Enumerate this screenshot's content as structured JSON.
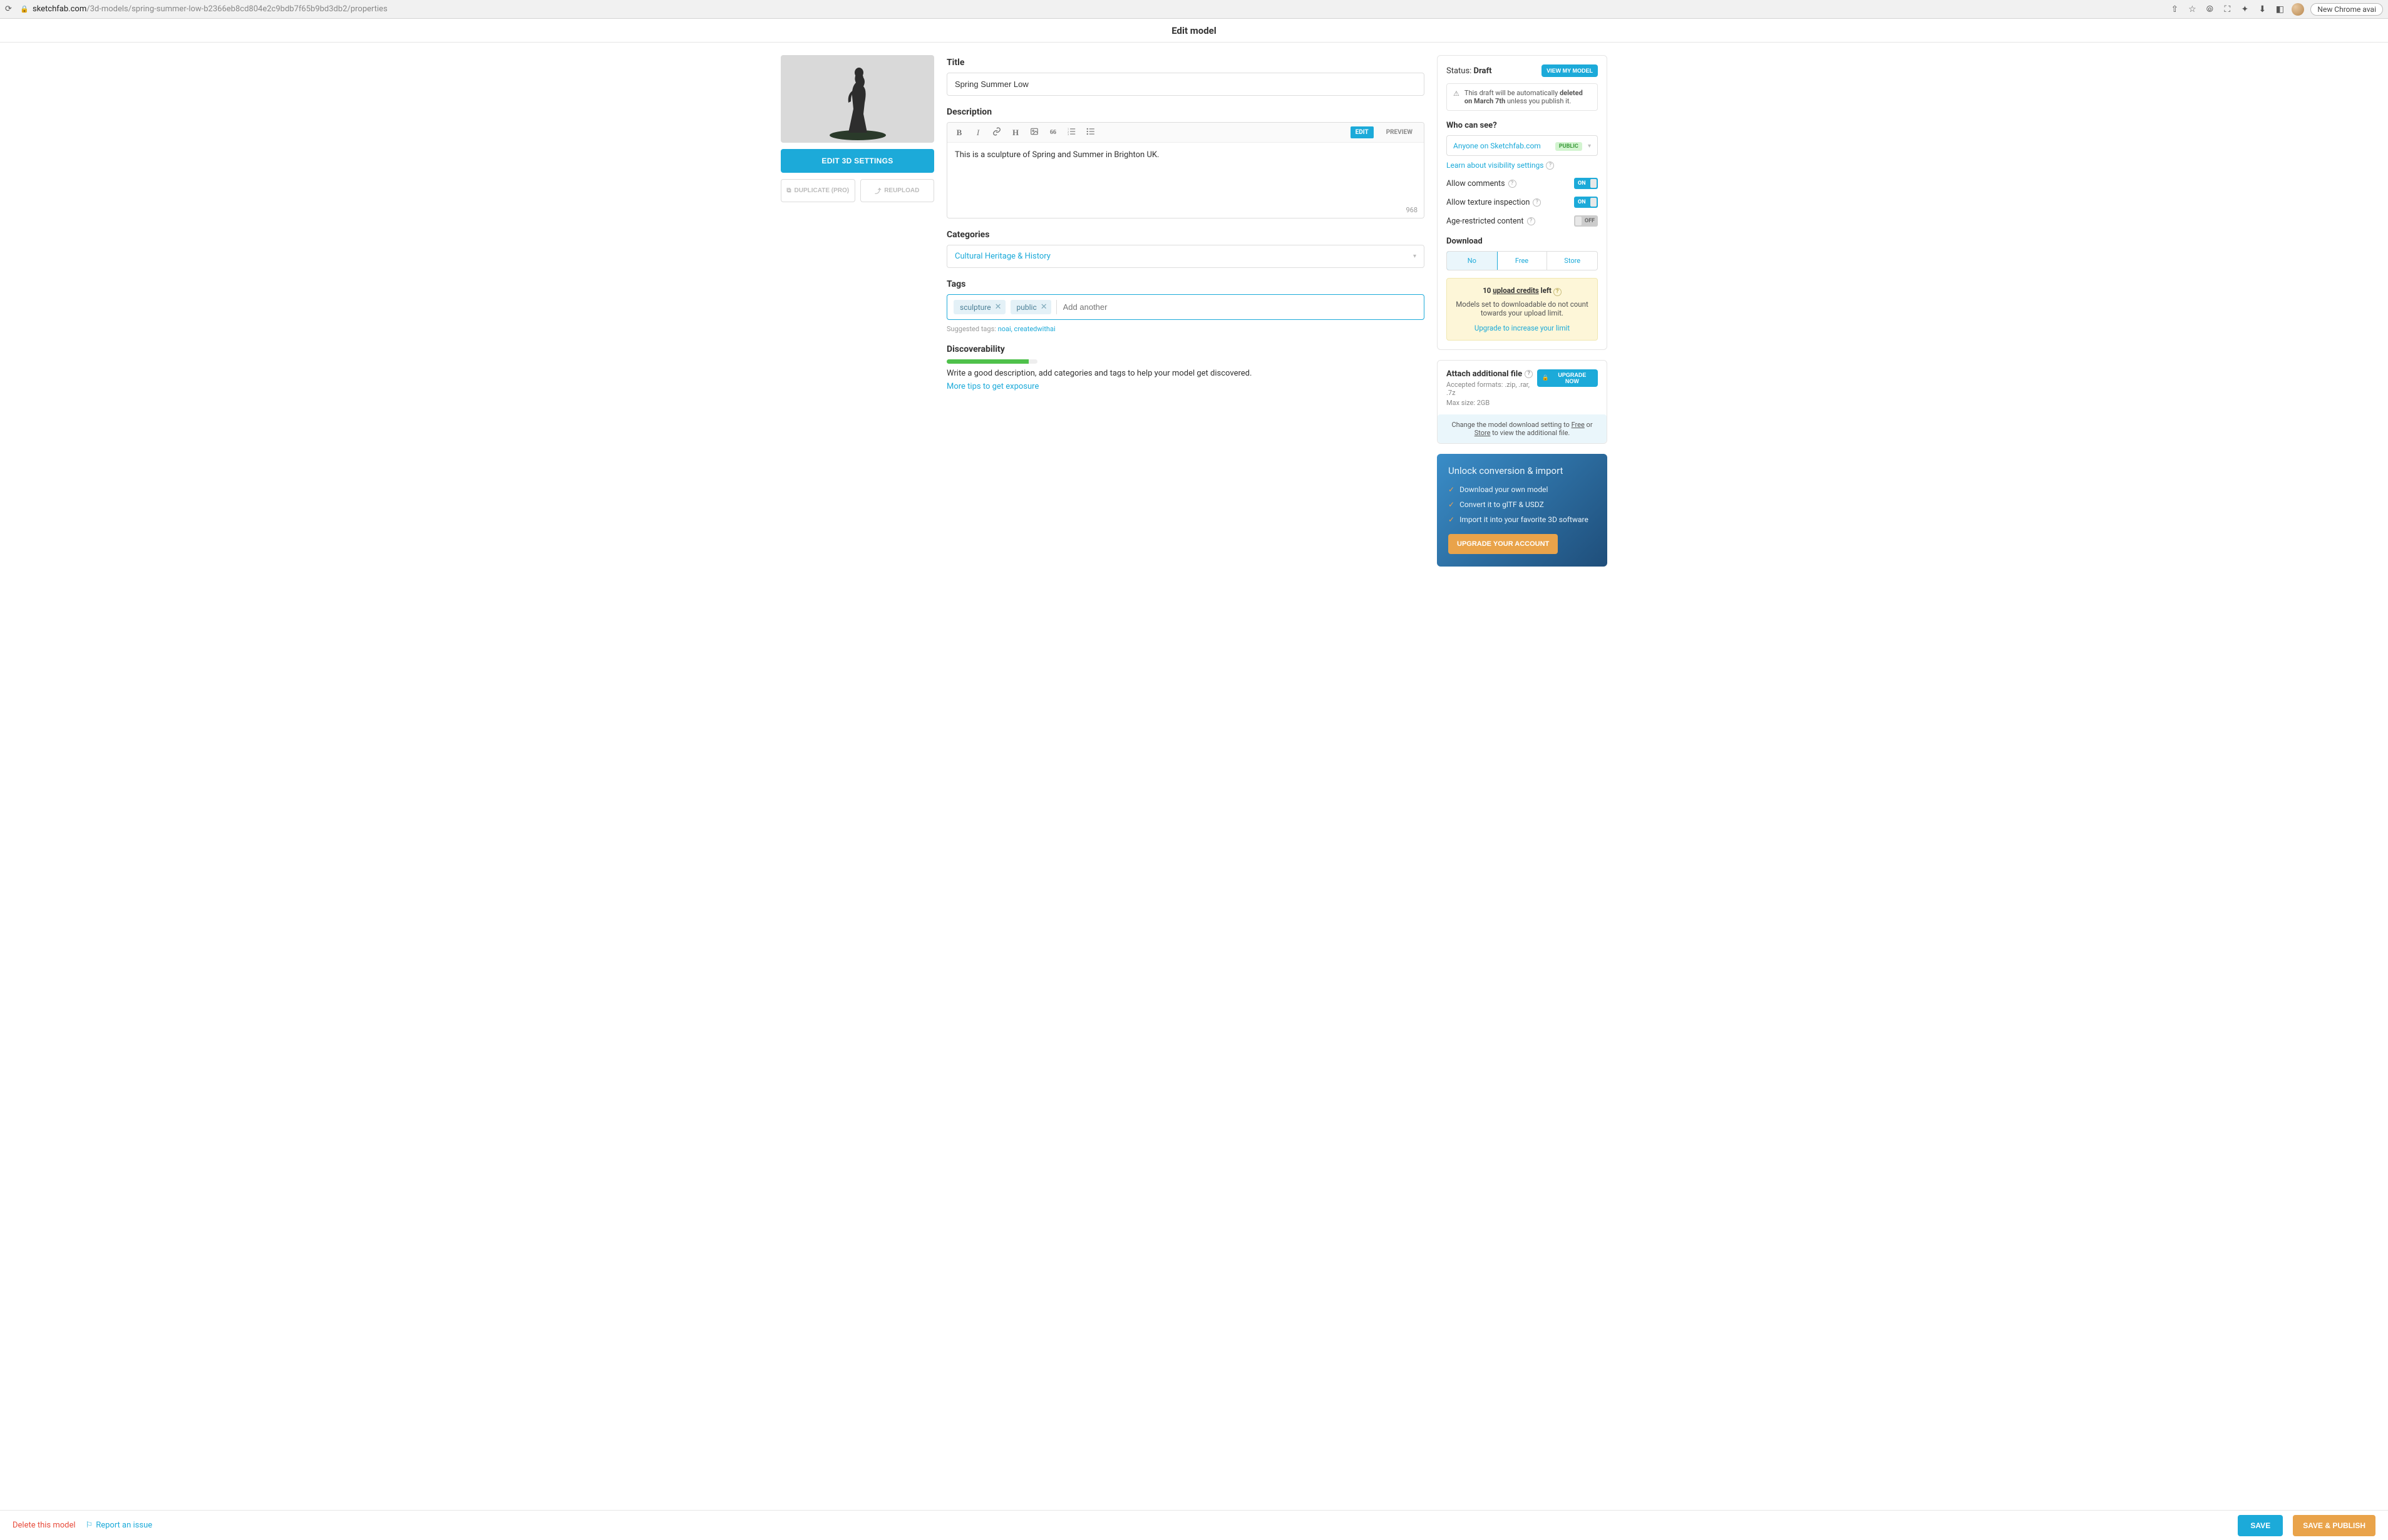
{
  "browser": {
    "domain": "sketchfab.com",
    "path": "/3d-models/spring-summer-low-b2366eb8cd804e2c9bdb7f65b9bd3db2/properties",
    "new_chrome": "New Chrome avai"
  },
  "header": {
    "title": "Edit model"
  },
  "left": {
    "edit_3d": "EDIT 3D SETTINGS",
    "duplicate": "DUPLICATE (PRO)",
    "reupload": "REUPLOAD"
  },
  "form": {
    "title_label": "Title",
    "title_value": "Spring Summer Low",
    "description_label": "Description",
    "description_value": "This is a sculpture of Spring and Summer in Brighton UK.",
    "char_count": "968",
    "toolbar": {
      "bold": "B",
      "italic": "I",
      "link": "🔗",
      "heading": "H",
      "quote": "66",
      "olist": "≣",
      "ulist": "≡",
      "edit_tab": "EDIT",
      "preview_tab": "PREVIEW"
    },
    "categories_label": "Categories",
    "category_value": "Cultural Heritage & History",
    "tags_label": "Tags",
    "tags": [
      "sculpture",
      "public"
    ],
    "tag_placeholder": "Add another",
    "suggested_label": "Suggested tags: ",
    "suggested_tags": "noai, createdwithai",
    "discover_label": "Discoverability",
    "discover_text": "Write a good description, add categories and tags to help your model get discovered.",
    "more_tips": "More tips to get exposure"
  },
  "side": {
    "status_prefix": "Status: ",
    "status_value": "Draft",
    "view_btn": "VIEW MY MODEL",
    "draft_warning_1": "This draft will be automatically ",
    "draft_warning_bold": "deleted on March 7th",
    "draft_warning_2": " unless you publish it.",
    "who_can_see": "Who can see?",
    "visibility_value": "Anyone on Sketchfab.com",
    "public_badge": "PUBLIC",
    "learn_visibility": "Learn about visibility settings",
    "allow_comments": "Allow comments",
    "allow_texture": "Allow texture inspection",
    "age_restricted": "Age-restricted content",
    "on": "ON",
    "off": "OFF",
    "download_label": "Download",
    "dl_no": "No",
    "dl_free": "Free",
    "dl_store": "Store",
    "credits_prefix": "10 ",
    "credits_underline": "upload credits",
    "credits_suffix": " left",
    "credits_desc": "Models set to downloadable do not count towards your upload limit.",
    "credits_upgrade": "Upgrade to increase your limit",
    "attach_title": "Attach additional file",
    "attach_formats": "Accepted formats: .zip, .rar, .7z",
    "attach_max": "Max size: 2GB",
    "upgrade_now": "UPGRADE NOW",
    "attach_note_1": "Change the model download setting to ",
    "attach_note_free": "Free",
    "attach_note_or": " or ",
    "attach_note_store": "Store",
    "attach_note_2": " to view the additional file.",
    "promo_title": "Unlock conversion & import",
    "promo_items": [
      "Download your own model",
      "Convert it to glTF & USDZ",
      "Import it into your favorite 3D software"
    ],
    "promo_btn": "UPGRADE YOUR ACCOUNT"
  },
  "footer": {
    "delete": "Delete this model",
    "report": "Report an issue",
    "save": "SAVE",
    "publish": "SAVE & PUBLISH"
  }
}
